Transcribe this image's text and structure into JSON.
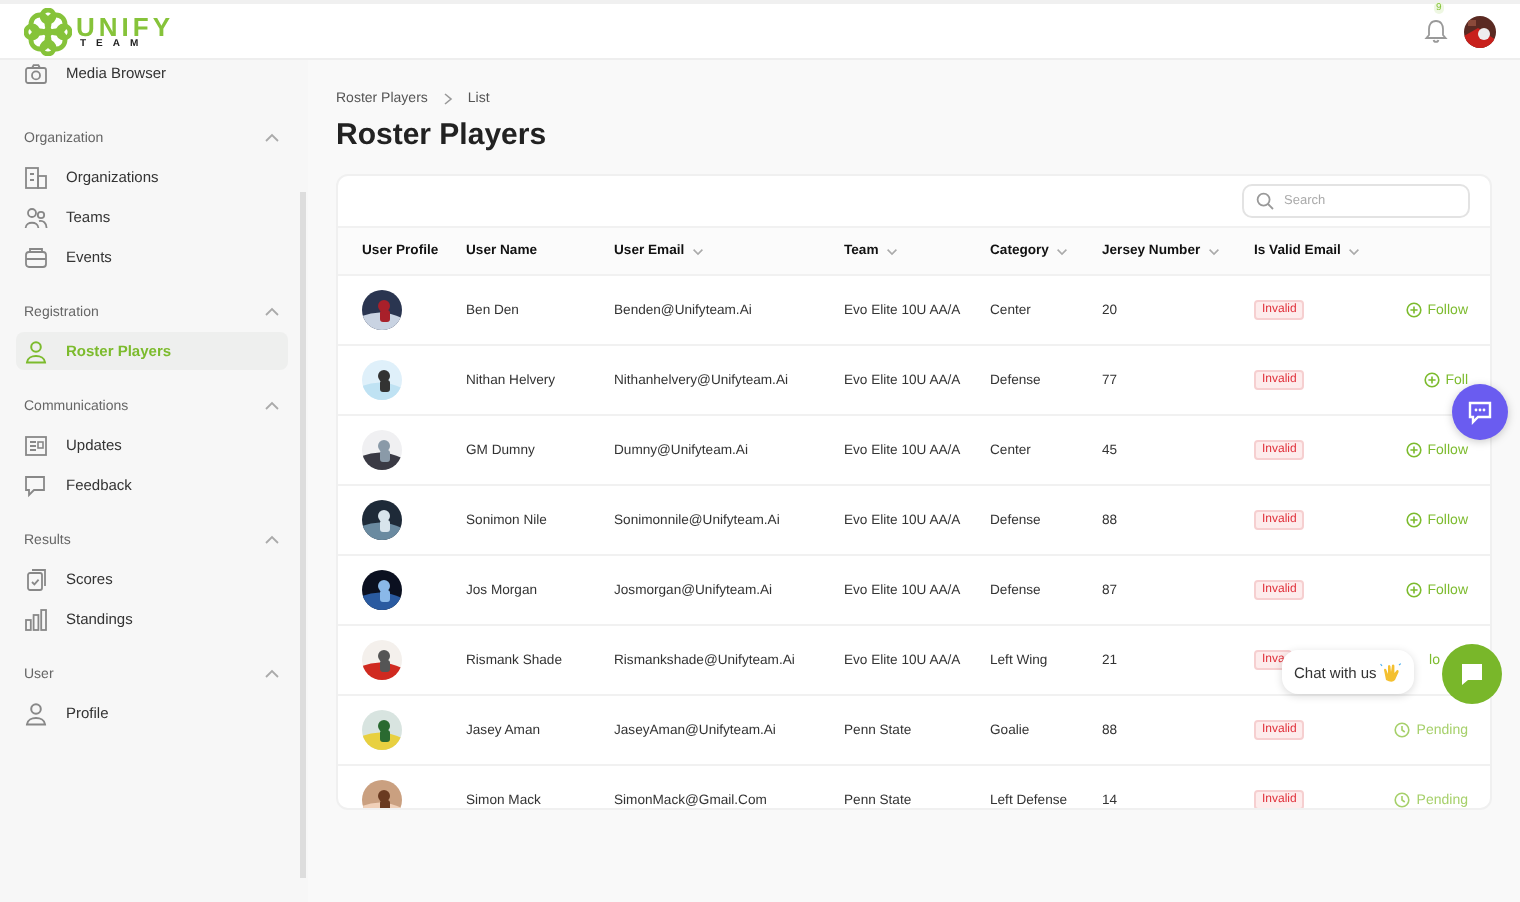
{
  "header": {
    "logo_text": "UNIFY",
    "logo_subtext": "TEAM",
    "notification_count": "9"
  },
  "sidebar": {
    "items": [
      {
        "label": "Media Browser",
        "kind": "camera",
        "selected": false
      }
    ],
    "sections": [
      {
        "title": "Organization",
        "expanded": true,
        "items": [
          {
            "label": "Organizations",
            "kind": "building",
            "selected": false
          },
          {
            "label": "Teams",
            "kind": "people",
            "selected": false
          },
          {
            "label": "Events",
            "kind": "tray",
            "selected": false
          }
        ]
      },
      {
        "title": "Registration",
        "expanded": true,
        "items": [
          {
            "label": "Roster Players",
            "kind": "person",
            "selected": true
          }
        ]
      },
      {
        "title": "Communications",
        "expanded": true,
        "items": [
          {
            "label": "Updates",
            "kind": "news",
            "selected": false
          },
          {
            "label": "Feedback",
            "kind": "chat",
            "selected": false
          }
        ]
      },
      {
        "title": "Results",
        "expanded": true,
        "items": [
          {
            "label": "Scores",
            "kind": "clipboard",
            "selected": false
          },
          {
            "label": "Standings",
            "kind": "bars",
            "selected": false
          }
        ]
      },
      {
        "title": "User",
        "expanded": true,
        "items": [
          {
            "label": "Profile",
            "kind": "person",
            "selected": false
          }
        ]
      }
    ]
  },
  "breadcrumb": [
    "Roster Players",
    "List"
  ],
  "page_title": "Roster Players",
  "search": {
    "placeholder": "Search"
  },
  "table": {
    "columns": [
      {
        "label": "User Profile",
        "sortable": false
      },
      {
        "label": "User Name",
        "sortable": false
      },
      {
        "label": "User Email",
        "sortable": true
      },
      {
        "label": "Team",
        "sortable": true
      },
      {
        "label": "Category",
        "sortable": true
      },
      {
        "label": "Jersey Number",
        "sortable": true
      },
      {
        "label": "Is Valid Email",
        "sortable": true
      }
    ],
    "rows": [
      {
        "name": "Ben Den",
        "email": "Benden@Unifyteam.Ai",
        "team": "Evo Elite 10U AA/A",
        "category": "Center",
        "jersey": "20",
        "validity": "Invalid",
        "action": {
          "kind": "follow",
          "label": "Follow"
        }
      },
      {
        "name": "Nithan Helvery",
        "email": "Nithanhelvery@Unifyteam.Ai",
        "team": "Evo Elite 10U AA/A",
        "category": "Defense",
        "jersey": "77",
        "validity": "Invalid",
        "action": {
          "kind": "follow",
          "label": "Foll"
        }
      },
      {
        "name": "GM Dumny",
        "email": "Dumny@Unifyteam.Ai",
        "team": "Evo Elite 10U AA/A",
        "category": "Center",
        "jersey": "45",
        "validity": "Invalid",
        "action": {
          "kind": "follow",
          "label": "Follow"
        }
      },
      {
        "name": "Sonimon Nile",
        "email": "Sonimonnile@Unifyteam.Ai",
        "team": "Evo Elite 10U AA/A",
        "category": "Defense",
        "jersey": "88",
        "validity": "Invalid",
        "action": {
          "kind": "follow",
          "label": "Follow"
        }
      },
      {
        "name": "Jos Morgan",
        "email": "Josmorgan@Unifyteam.Ai",
        "team": "Evo Elite 10U AA/A",
        "category": "Defense",
        "jersey": "87",
        "validity": "Invalid",
        "action": {
          "kind": "follow",
          "label": "Follow"
        }
      },
      {
        "name": "Rismank Shade",
        "email": "Rismankshade@Unifyteam.Ai",
        "team": "Evo Elite 10U AA/A",
        "category": "Left Wing",
        "jersey": "21",
        "validity": "Inva",
        "action": {
          "kind": "follow",
          "label": "lo",
          "icon_hidden": true
        }
      },
      {
        "name": "Jasey Aman",
        "email": "JaseyAman@Unifyteam.Ai",
        "team": "Penn State",
        "category": "Goalie",
        "jersey": "88",
        "validity": "Invalid",
        "action": {
          "kind": "pending",
          "label": "Pending"
        }
      },
      {
        "name": "Simon Mack",
        "email": "SimonMack@Gmail.Com",
        "team": "Penn State",
        "category": "Left Defense",
        "jersey": "14",
        "validity": "Invalid",
        "action": {
          "kind": "pending",
          "label": "Pending"
        }
      }
    ]
  },
  "chat": {
    "label": "Chat with us"
  }
}
